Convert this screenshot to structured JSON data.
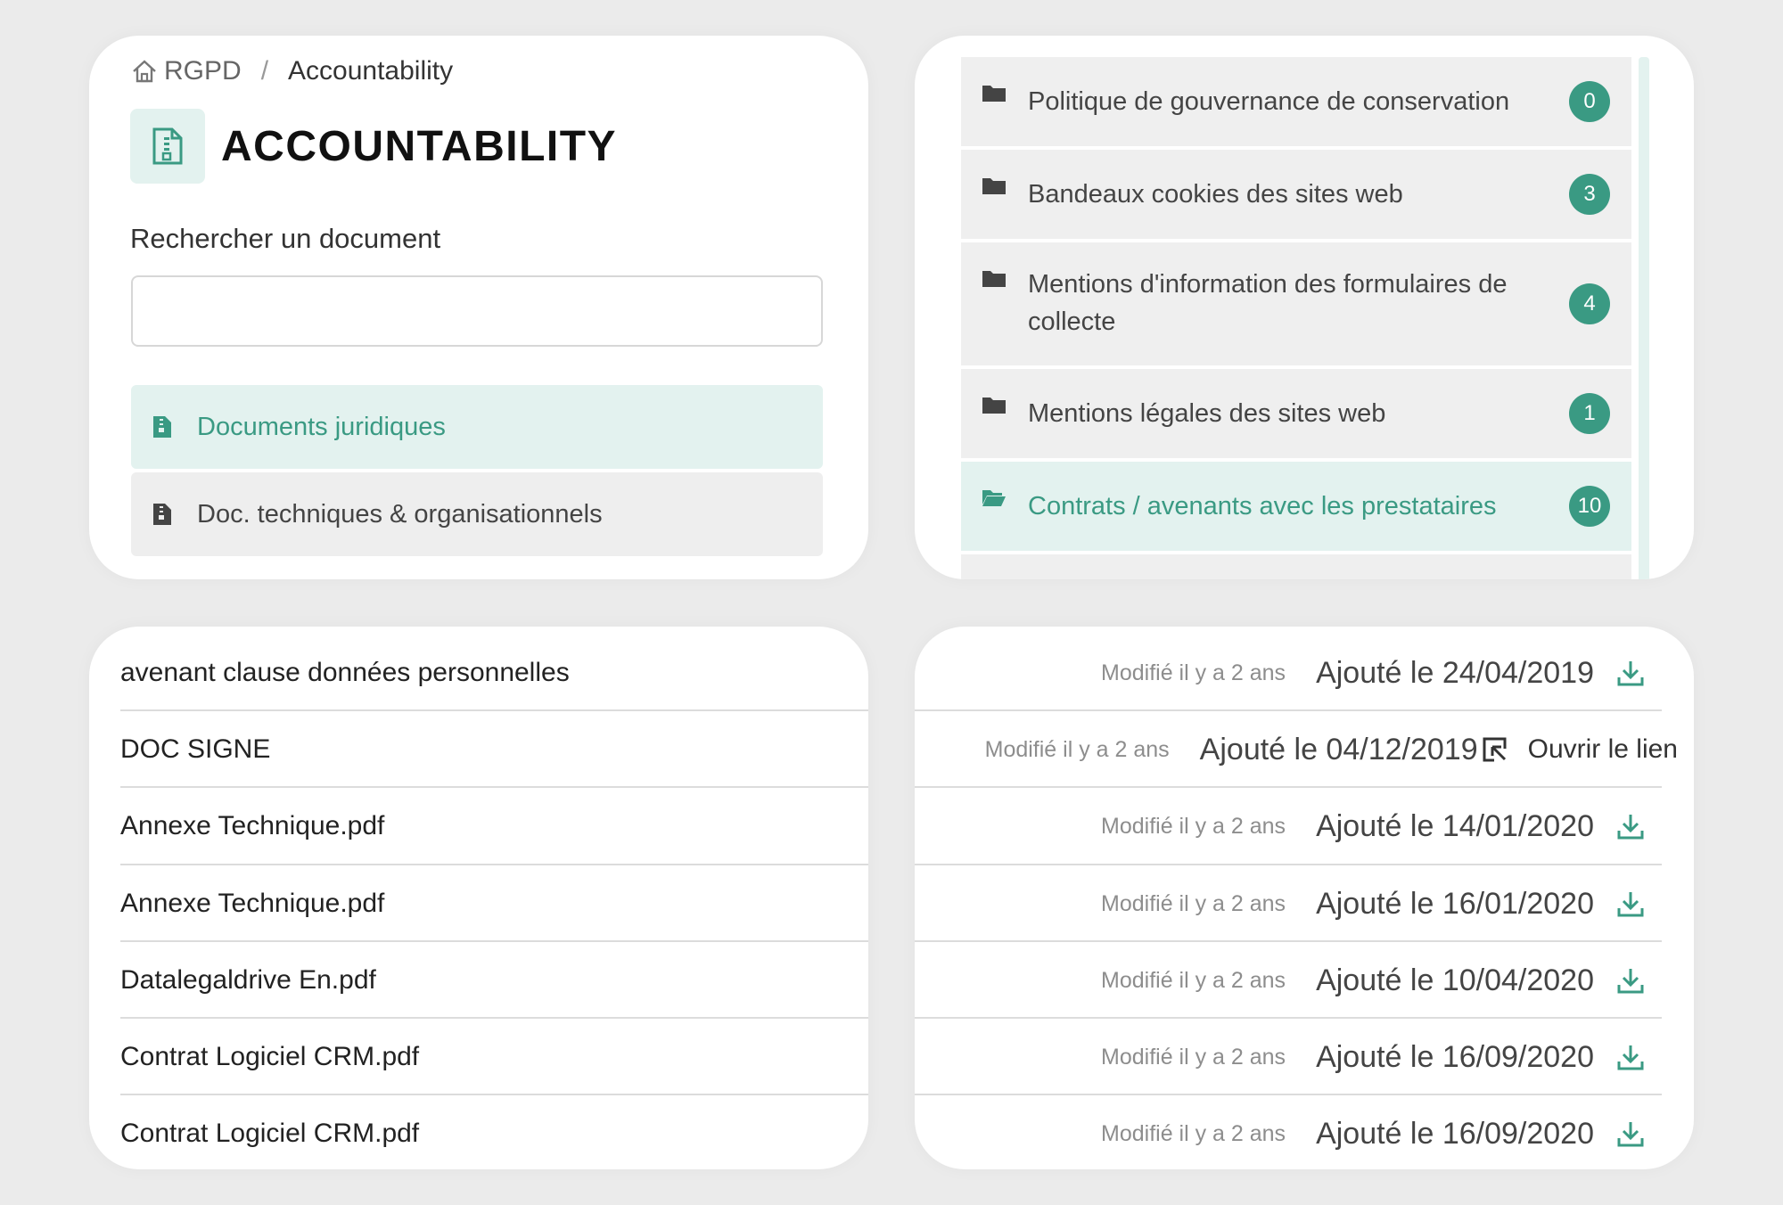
{
  "breadcrumb": {
    "home": "RGPD",
    "separator": "/",
    "current": "Accountability"
  },
  "page_title": "ACCOUNTABILITY",
  "search": {
    "label": "Rechercher un document",
    "value": "",
    "placeholder": ""
  },
  "categories": [
    {
      "label": "Documents juridiques",
      "active": true
    },
    {
      "label": "Doc. techniques & organisationnels",
      "active": false
    }
  ],
  "folders": [
    {
      "label": "Politique de gouvernance de conservation",
      "count": "0",
      "active": false
    },
    {
      "label": "Bandeaux cookies des sites web",
      "count": "3",
      "active": false
    },
    {
      "label": "Mentions d'information des formulaires de collecte",
      "count": "4",
      "active": false
    },
    {
      "label": "Mentions légales des sites web",
      "count": "1",
      "active": false
    },
    {
      "label": "Contrats / avenants avec les prestataires",
      "count": "10",
      "active": true
    }
  ],
  "documents": [
    {
      "name": "avenant clause données personnelles",
      "modified": "Modifié il y a 2 ans",
      "added": "Ajouté le 24/04/2019",
      "action": "download"
    },
    {
      "name": "DOC SIGNE",
      "modified": "Modifié il y a 2 ans",
      "added": "Ajouté le 04/12/2019",
      "action": "link",
      "action_label": "Ouvrir le lien"
    },
    {
      "name": "Annexe Technique.pdf",
      "modified": "Modifié il y a 2 ans",
      "added": "Ajouté le 14/01/2020",
      "action": "download"
    },
    {
      "name": "Annexe Technique.pdf",
      "modified": "Modifié il y a 2 ans",
      "added": "Ajouté le 16/01/2020",
      "action": "download"
    },
    {
      "name": "Datalegaldrive En.pdf",
      "modified": "Modifié il y a 2 ans",
      "added": "Ajouté le 10/04/2020",
      "action": "download"
    },
    {
      "name": "Contrat Logiciel CRM.pdf",
      "modified": "Modifié il y a 2 ans",
      "added": "Ajouté le 16/09/2020",
      "action": "download"
    },
    {
      "name": "Contrat Logiciel CRM.pdf",
      "modified": "Modifié il y a 2 ans",
      "added": "Ajouté le 16/09/2020",
      "action": "download"
    }
  ],
  "colors": {
    "accent": "#3a9a83",
    "accent_light": "#e3f2ef",
    "background": "#ebebeb"
  },
  "icons": {
    "home": "home-icon",
    "document": "document-icon",
    "folder": "folder-icon",
    "folder_open": "folder-open-icon",
    "download": "download-icon",
    "external_link": "external-link-icon"
  }
}
